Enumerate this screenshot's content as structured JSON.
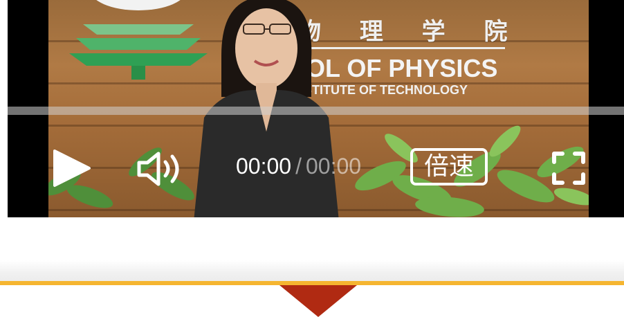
{
  "video": {
    "sign": {
      "cn_text": "物 理 学 院",
      "en_line1": "OL OF PHYSICS",
      "en_line2": "NSTITUTE OF TECHNOLOGY"
    },
    "controls": {
      "play_icon": "play-icon",
      "volume_icon": "volume-icon",
      "current_time": "00:00",
      "separator": "/",
      "duration": "00:00",
      "speed_label": "倍速",
      "fullscreen_icon": "fullscreen-icon"
    },
    "progress": 0
  },
  "colors": {
    "accent_orange": "#f5b530",
    "arrow_red": "#b02a12",
    "player_bg": "#000000"
  }
}
